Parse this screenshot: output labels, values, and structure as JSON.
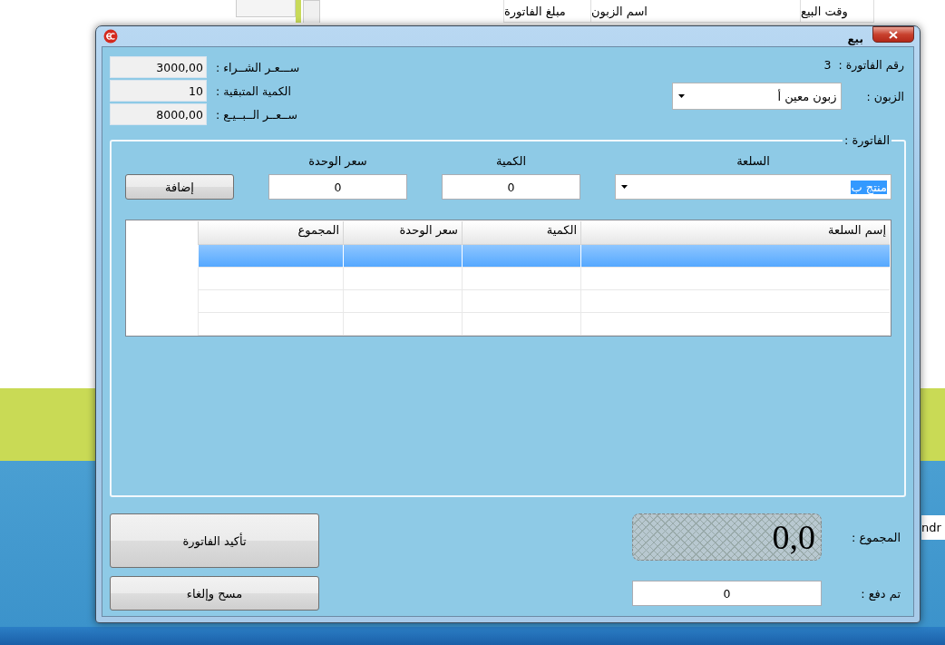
{
  "background_app": {
    "columns": [
      "وقت البيع",
      "اسم الزبون",
      "مبلغ الفاتورة"
    ],
    "side_text": "ndr"
  },
  "window": {
    "title": "بيع"
  },
  "invoice_number": {
    "label": "رقم الفاتورة :",
    "value": "3"
  },
  "customer": {
    "label": "الزبون :",
    "value": "زبون معين أ"
  },
  "product_info": [
    {
      "label": "ســـعـر الشــراء :",
      "value": "3000,00"
    },
    {
      "label": "الكمية المتبقية :",
      "value": "10"
    },
    {
      "label": "ســعــر الــبــيـع :",
      "value": "8000,00"
    }
  ],
  "invoice_group": {
    "legend": "الفاتورة :",
    "product": {
      "label": "السلعة",
      "value": "منتج ب"
    },
    "quantity": {
      "label": "الكمية",
      "value": "0"
    },
    "unit_price": {
      "label": "سعر الوحدة",
      "value": "0"
    },
    "add_button": "إضافة",
    "table": {
      "columns": [
        "إسم السلعة",
        "الكمية",
        "سعر الوحدة",
        "المجموع"
      ],
      "rows": [
        {
          "selected": true
        },
        {
          "selected": false
        },
        {
          "selected": false
        },
        {
          "selected": false
        }
      ]
    }
  },
  "total": {
    "label": "المجموع :",
    "value": "0,0"
  },
  "paid": {
    "label": "تم دفع :",
    "value": "0"
  },
  "buttons": [
    "تأكيد الفاتورة",
    "مسح وإلغاء"
  ]
}
